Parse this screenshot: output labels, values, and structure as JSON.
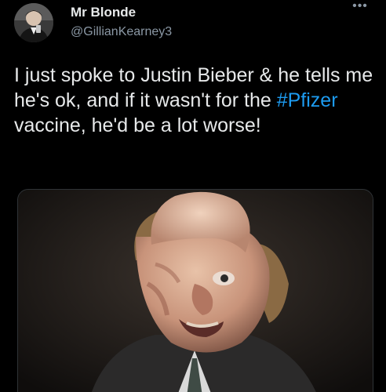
{
  "author": {
    "display_name": "Mr Blonde",
    "handle": "@GillianKearney3",
    "avatar_icon": "profile-photo"
  },
  "more_icon": "more-horizontal-icon",
  "tweet": {
    "text_before": "I just spoke to Justin Bieber & he tells me he's ok, and if it wasn't for the ",
    "hashtag": "#Pfizer",
    "text_after": " vaccine, he'd be a lot worse!"
  },
  "media": {
    "kind": "photo",
    "subject": "person-with-facial-prosthetics"
  },
  "colors": {
    "background": "#000000",
    "text": "#e7e9ea",
    "secondary_text": "#8b98a5",
    "link": "#1d9bf0",
    "border": "#2f3336"
  }
}
